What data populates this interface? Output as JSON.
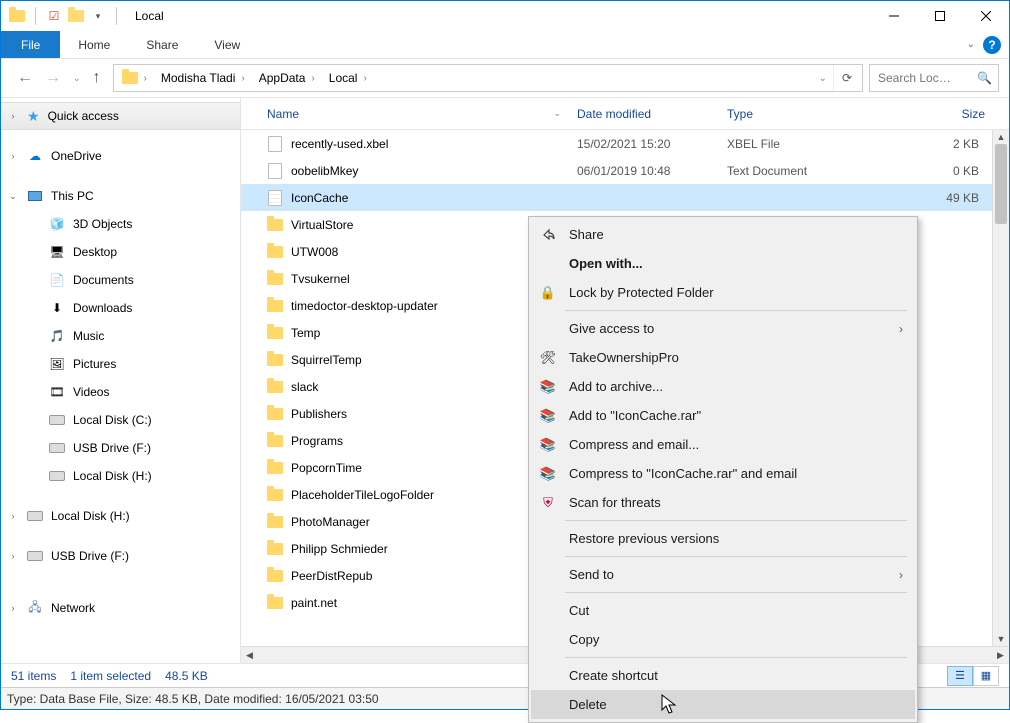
{
  "titlebar": {
    "app_title": "Local"
  },
  "menubar": {
    "file": "File",
    "tabs": [
      "Home",
      "Share",
      "View"
    ]
  },
  "breadcrumb": {
    "segments": [
      "Modisha Tladi",
      "AppData",
      "Local"
    ]
  },
  "search": {
    "placeholder": "Search Loc…"
  },
  "columns": {
    "name": "Name",
    "date": "Date modified",
    "type": "Type",
    "size": "Size"
  },
  "nav_pane": {
    "quick_access": "Quick access",
    "onedrive": "OneDrive",
    "this_pc": "This PC",
    "this_pc_items": [
      "3D Objects",
      "Desktop",
      "Documents",
      "Downloads",
      "Music",
      "Pictures",
      "Videos",
      "Local Disk (C:)",
      "USB Drive (F:)",
      "Local Disk (H:)"
    ],
    "extra_drives": [
      "Local Disk (H:)",
      "USB Drive (F:)"
    ],
    "network": "Network"
  },
  "files": [
    {
      "name": "recently-used.xbel",
      "date": "15/02/2021 15:20",
      "type": "XBEL File",
      "size": "2 KB",
      "icon": "file"
    },
    {
      "name": "oobelibMkey",
      "date": "06/01/2019 10:48",
      "type": "Text Document",
      "size": "0 KB",
      "icon": "file"
    },
    {
      "name": "IconCache",
      "date": "",
      "type": "",
      "size": "49 KB",
      "icon": "db",
      "selected": true
    },
    {
      "name": "VirtualStore",
      "icon": "folder"
    },
    {
      "name": "UTW008",
      "icon": "folder"
    },
    {
      "name": "Tvsukernel",
      "icon": "folder"
    },
    {
      "name": "timedoctor-desktop-updater",
      "icon": "folder"
    },
    {
      "name": "Temp",
      "icon": "folder"
    },
    {
      "name": "SquirrelTemp",
      "icon": "folder"
    },
    {
      "name": "slack",
      "icon": "folder"
    },
    {
      "name": "Publishers",
      "icon": "folder"
    },
    {
      "name": "Programs",
      "icon": "folder"
    },
    {
      "name": "PopcornTime",
      "icon": "folder"
    },
    {
      "name": "PlaceholderTileLogoFolder",
      "icon": "folder"
    },
    {
      "name": "PhotoManager",
      "icon": "folder"
    },
    {
      "name": "Philipp Schmieder",
      "icon": "folder"
    },
    {
      "name": "PeerDistRepub",
      "icon": "folder"
    },
    {
      "name": "paint.net",
      "icon": "folder"
    }
  ],
  "context_menu": {
    "share": "Share",
    "open_with": "Open with...",
    "lock": "Lock by Protected Folder",
    "give_access": "Give access to",
    "take_ownership": "TakeOwnershipPro",
    "add_archive": "Add to archive...",
    "add_to_named": "Add to \"IconCache.rar\"",
    "compress_email": "Compress and email...",
    "compress_named_email": "Compress to \"IconCache.rar\" and email",
    "scan_threats": "Scan for threats",
    "restore_prev": "Restore previous versions",
    "send_to": "Send to",
    "cut": "Cut",
    "copy": "Copy",
    "create_shortcut": "Create shortcut",
    "delete": "Delete"
  },
  "status": {
    "items": "51 items",
    "selected": "1 item selected",
    "sel_size": "48.5 KB"
  },
  "infobar": {
    "text": "Type: Data Base File, Size: 48.5 KB, Date modified: 16/05/2021 03:50"
  }
}
